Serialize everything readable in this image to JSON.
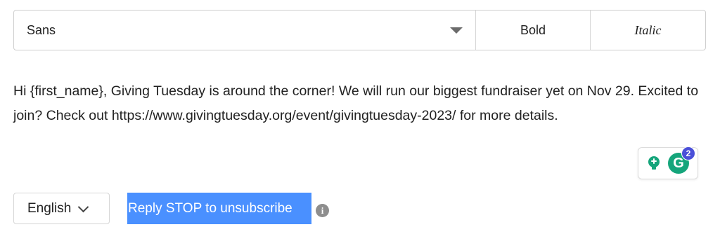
{
  "toolbar": {
    "font_value": "Sans",
    "bold_label": "Bold",
    "italic_label": "Italic"
  },
  "message": {
    "text": "Hi {first_name}, Giving Tuesday is around the corner! We will run our biggest fundraiser yet on Nov 29. Excited to join? Check out https://www.givingtuesday.org/event/givingtuesday-2023/ for more details."
  },
  "grammarly": {
    "logo_letter": "G",
    "badge_count": "2",
    "logo_color": "#15a57b",
    "badge_color": "#4a4fd8"
  },
  "footer": {
    "language": "English",
    "unsubscribe_text": "Reply STOP to unsubscribe",
    "info_glyph": "i",
    "highlight_color": "#4a90ff"
  }
}
